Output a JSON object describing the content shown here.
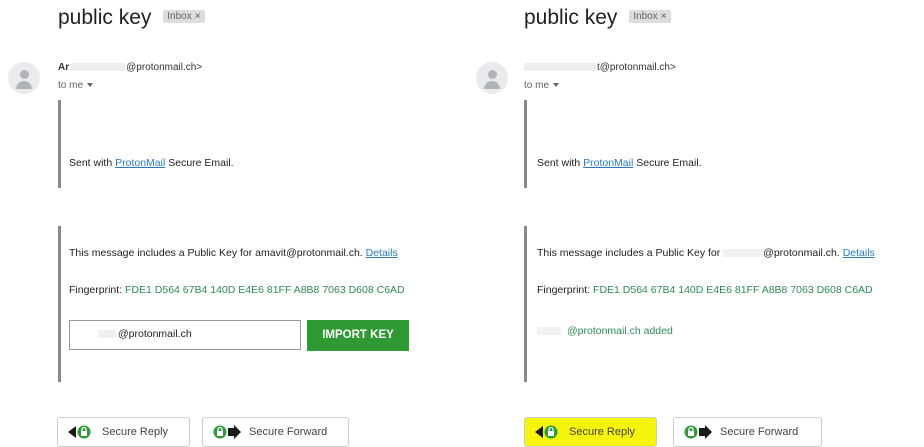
{
  "left": {
    "subject": "public key",
    "label": "Inbox",
    "label_close": "×",
    "sender_name": "Ar",
    "sender_email": "@protonmail.ch>",
    "recipient": "to me",
    "sent_prefix": "Sent with ",
    "sent_link": "ProtonMail",
    "sent_suffix": " Secure Email.",
    "pk_prefix": "This message includes a Public Key for amavit@protonmail.ch. ",
    "details_link": "Details",
    "fingerprint_label": "Fingerprint: ",
    "fingerprint_value": "FDE1 D564 67B4 140D E4E6 81FF A8B8 7063 D608 C6AD",
    "email_input_value": "@protonmail.ch",
    "import_button": "IMPORT KEY",
    "secure_reply": "Secure Reply",
    "secure_forward": "Secure Forward"
  },
  "right": {
    "subject": "public key",
    "label": "Inbox",
    "label_close": "×",
    "sender_email": "t@protonmail.ch>",
    "recipient": "to me",
    "sent_prefix": "Sent with ",
    "sent_link": "ProtonMail",
    "sent_suffix": " Secure Email.",
    "pk_prefix": "This message includes a Public Key for ",
    "pk_suffix": "@protonmail.ch. ",
    "details_link": "Details",
    "fingerprint_label": "Fingerprint: ",
    "fingerprint_value": "FDE1 D564 67B4 140D E4E6 81FF A8B8 7063 D608 C6AD",
    "added_text": "@protonmail.ch added",
    "secure_reply": "Secure Reply",
    "secure_forward": "Secure Forward"
  },
  "colors": {
    "link": "#2a7ac0",
    "green_text": "#2e8b57",
    "import_button_bg": "#2f9a33",
    "highlight": "#f6f40c",
    "quote_bar": "#888888"
  },
  "icons": {
    "avatar": "person-icon",
    "reply": "secure-reply-icon",
    "forward": "secure-forward-icon"
  }
}
